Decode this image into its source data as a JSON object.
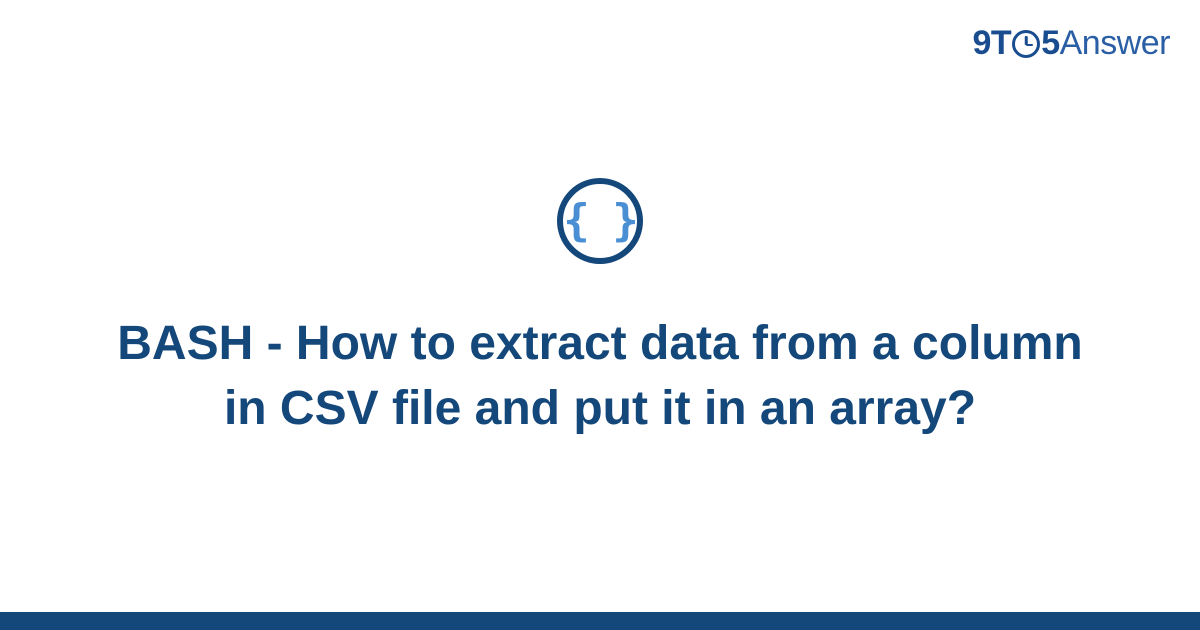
{
  "logo": {
    "part1": "9",
    "part2": "T",
    "part3": "5",
    "part4": "Answer"
  },
  "icon": {
    "braces": "{ }"
  },
  "title": "BASH - How to extract data from a column in CSV file and put it in an array?",
  "colors": {
    "primary": "#14477a",
    "accent": "#4a8fd4",
    "logo": "#1a4d8f"
  }
}
